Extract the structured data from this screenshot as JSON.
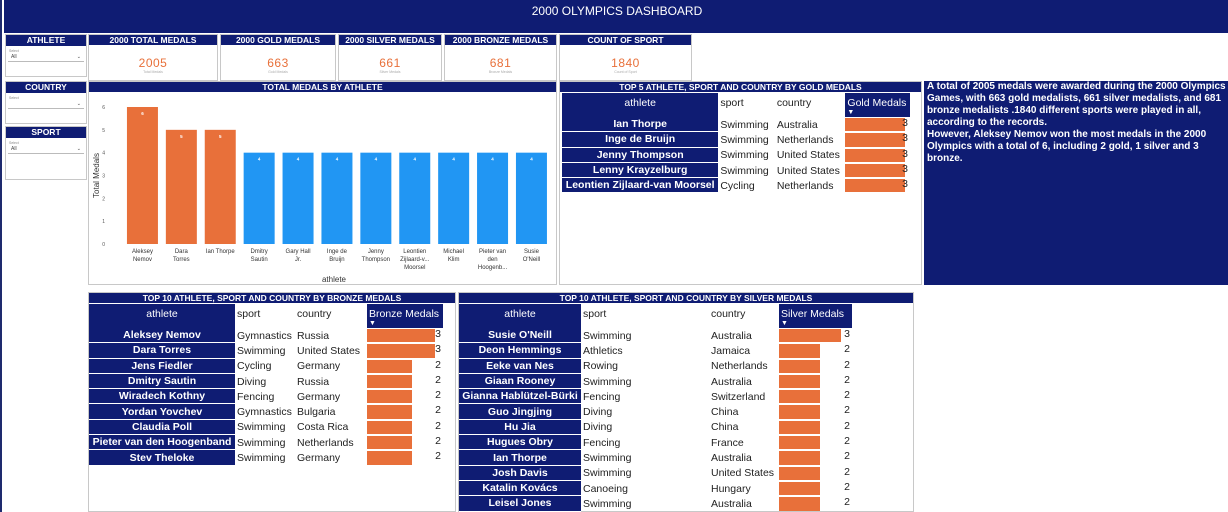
{
  "title": "2000 OLYMPICS DASHBOARD",
  "slicers": {
    "athlete": {
      "label": "ATHLETE",
      "caption": "Select",
      "value": "All"
    },
    "country": {
      "label": "COUNTRY",
      "caption": "Select",
      "value": ""
    },
    "sport": {
      "label": "SPORT",
      "caption": "Select",
      "value": "All"
    }
  },
  "cards": [
    {
      "label": "2000 TOTAL MEDALS",
      "value": "2005",
      "sub": "Total Medals"
    },
    {
      "label": "2000 GOLD MEDALS",
      "value": "663",
      "sub": "Gold Medals"
    },
    {
      "label": "2000 SILVER MEDALS",
      "value": "661",
      "sub": "Silver Medals"
    },
    {
      "label": "2000 BRONZE MEDALS",
      "value": "681",
      "sub": "Bronze Medals"
    },
    {
      "label": "COUNT OF SPORT",
      "value": "1840",
      "sub": "Count of Sport"
    }
  ],
  "colors": {
    "navy": "#0f1c73",
    "orange": "#e8703a",
    "blue": "#2196f3"
  },
  "chart_data": {
    "type": "bar",
    "title": "TOTAL MEDALS BY ATHLETE",
    "xlabel": "athlete",
    "ylabel": "Total Medals",
    "ylim": [
      0,
      6
    ],
    "yticks": [
      "0",
      "1",
      "2",
      "3",
      "4",
      "5",
      "6"
    ],
    "categories": [
      "Aleksey Nemov",
      "Dara Torres",
      "Ian Thorpe",
      "Dmitry Sautin",
      "Gary Hall Jr.",
      "Inge de Bruijn",
      "Jenny Thompson",
      "Leontien Zijlaard-v... Moorsel",
      "Michael Klim",
      "Pieter van den Hoogenb...",
      "Susie O'Neill"
    ],
    "values": [
      6,
      5,
      5,
      4,
      4,
      4,
      4,
      4,
      4,
      4,
      4
    ],
    "highlight": [
      true,
      true,
      true,
      false,
      false,
      false,
      false,
      false,
      false,
      false,
      false
    ]
  },
  "gold_table": {
    "title": "TOP 5 ATHLETE, SPORT AND COUNTRY BY GOLD MEDALS",
    "headers": [
      "athlete",
      "sport",
      "country",
      "Gold Medals"
    ],
    "rows": [
      [
        "Ian Thorpe",
        "Swimming",
        "Australia",
        3
      ],
      [
        "Inge de Bruijn",
        "Swimming",
        "Netherlands",
        3
      ],
      [
        "Jenny Thompson",
        "Swimming",
        "United States",
        3
      ],
      [
        "Lenny Krayzelburg",
        "Swimming",
        "United States",
        3
      ],
      [
        "Leontien Zijlaard-van Moorsel",
        "Cycling",
        "Netherlands",
        3
      ]
    ]
  },
  "summary": "A total of 2005 medals were awarded during the 2000 Olympics Games, with 663 gold medalists, 661 silver medalists, and 681 bronze medalists .1840 different sports were played in all, according to the records.\nHowever, Aleksey Nemov won the most medals in the 2000 Olympics with a total of 6, including 2 gold, 1 silver and 3 bronze.",
  "bronze_table": {
    "title": "TOP 10 ATHLETE, SPORT AND COUNTRY BY BRONZE MEDALS",
    "headers": [
      "athlete",
      "sport",
      "country",
      "Bronze Medals"
    ],
    "rows": [
      [
        "Aleksey Nemov",
        "Gymnastics",
        "Russia",
        3
      ],
      [
        "Dara Torres",
        "Swimming",
        "United States",
        3
      ],
      [
        "Jens Fiedler",
        "Cycling",
        "Germany",
        2
      ],
      [
        "Dmitry Sautin",
        "Diving",
        "Russia",
        2
      ],
      [
        "Wiradech Kothny",
        "Fencing",
        "Germany",
        2
      ],
      [
        "Yordan Yovchev",
        "Gymnastics",
        "Bulgaria",
        2
      ],
      [
        "Claudia Poll",
        "Swimming",
        "Costa Rica",
        2
      ],
      [
        "Pieter van den Hoogenband",
        "Swimming",
        "Netherlands",
        2
      ],
      [
        "Stev Theloke",
        "Swimming",
        "Germany",
        2
      ]
    ]
  },
  "silver_table": {
    "title": "TOP 10 ATHLETE, SPORT AND COUNTRY BY SILVER MEDALS",
    "headers": [
      "athlete",
      "sport",
      "country",
      "Silver Medals"
    ],
    "rows": [
      [
        "Susie O'Neill",
        "Swimming",
        "Australia",
        3
      ],
      [
        "Deon Hemmings",
        "Athletics",
        "Jamaica",
        2
      ],
      [
        "Eeke van Nes",
        "Rowing",
        "Netherlands",
        2
      ],
      [
        "Giaan Rooney",
        "Swimming",
        "Australia",
        2
      ],
      [
        "Gianna Hablützel-Bürki",
        "Fencing",
        "Switzerland",
        2
      ],
      [
        "Guo Jingjing",
        "Diving",
        "China",
        2
      ],
      [
        "Hu Jia",
        "Diving",
        "China",
        2
      ],
      [
        "Hugues Obry",
        "Fencing",
        "France",
        2
      ],
      [
        "Ian Thorpe",
        "Swimming",
        "Australia",
        2
      ],
      [
        "Josh Davis",
        "Swimming",
        "United States",
        2
      ],
      [
        "Katalin Kovács",
        "Canoeing",
        "Hungary",
        2
      ],
      [
        "Leisel Jones",
        "Swimming",
        "Australia",
        2
      ]
    ]
  }
}
